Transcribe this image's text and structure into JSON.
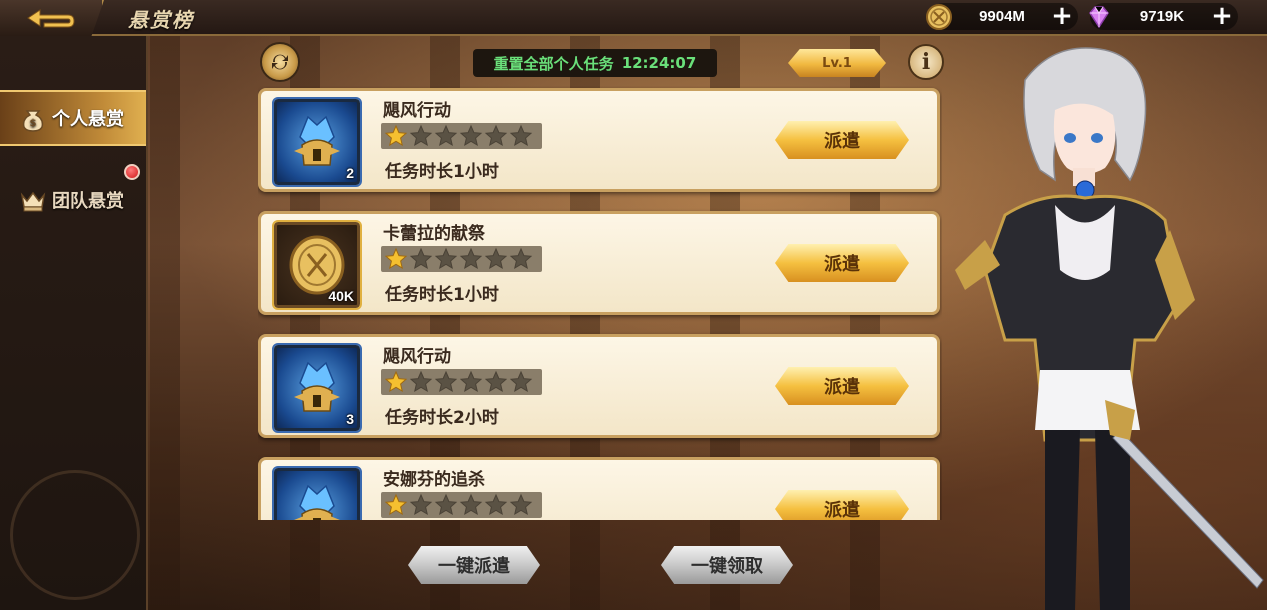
{
  "header": {
    "title": "悬赏榜",
    "gold": {
      "value": "9904M",
      "icon": "coin-icon"
    },
    "diamond": {
      "value": "9719K",
      "icon": "diamond-icon"
    }
  },
  "sidebar": {
    "tabs": [
      {
        "label": "个人悬赏",
        "icon": "money-bag-icon",
        "active": true
      },
      {
        "label": "团队悬赏",
        "icon": "crown-icon",
        "active": false,
        "notification": true
      }
    ]
  },
  "toolbar": {
    "reset_label": "重置全部个人任务",
    "reset_timer": "12:24:07",
    "level": "Lv.1",
    "info": "i"
  },
  "tasks": [
    {
      "name": "飓风行动",
      "stars": 1,
      "max_stars": 6,
      "duration": "任务时长1小时",
      "reward_icon": "blue-crystal-helmet-icon",
      "reward_count": "2",
      "button": "派遣"
    },
    {
      "name": "卡蕾拉的献祭",
      "stars": 1,
      "max_stars": 6,
      "duration": "任务时长1小时",
      "reward_icon": "gold-coin-icon",
      "reward_count": "40K",
      "button": "派遣"
    },
    {
      "name": "飓风行动",
      "stars": 1,
      "max_stars": 6,
      "duration": "任务时长2小时",
      "reward_icon": "blue-crystal-helmet-icon",
      "reward_count": "3",
      "button": "派遣"
    },
    {
      "name": "安娜芬的追杀",
      "stars": 1,
      "max_stars": 6,
      "duration": "",
      "reward_icon": "blue-crystal-helmet-icon",
      "reward_count": "",
      "button": "派遣"
    }
  ],
  "footer": {
    "dispatch_all": "一键派遣",
    "claim_all": "一键领取"
  },
  "colors": {
    "accent_gold": "#f5c040",
    "timer_green": "#6ae07a",
    "card_bg": "#fdf6e6"
  }
}
